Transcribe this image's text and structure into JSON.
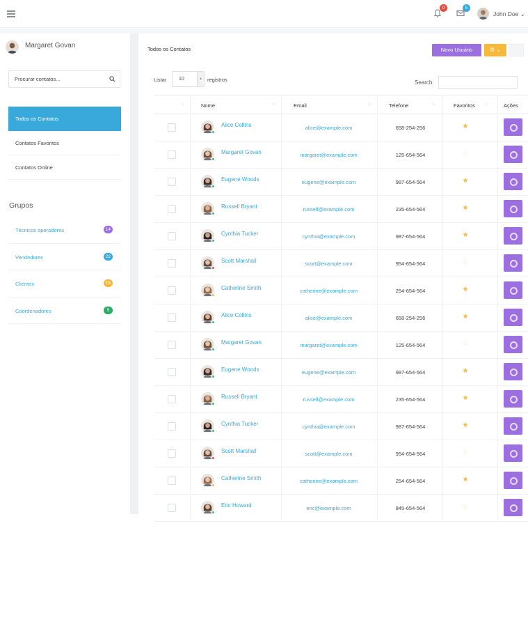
{
  "topbar": {
    "user_name": "John Doe",
    "user_caret": "⌄",
    "notification_count": "0",
    "message_count": "5",
    "colors": {
      "notification_badge": "#e74c3c",
      "message_badge": "#39a9db"
    }
  },
  "sidebar": {
    "profile_name": "Margaret Govan",
    "search_placeholder": "Procurar contatos...",
    "menu": [
      {
        "label": "Todos os Contatos",
        "active": true
      },
      {
        "label": "Contatos Favoritos"
      },
      {
        "label": "Contatos Online"
      }
    ],
    "groups_title": "Grupos",
    "groups": [
      {
        "label": "Técnicos operadores",
        "count": "14",
        "color": "#9b6fe0"
      },
      {
        "label": "Vendedores",
        "count": "22",
        "color": "#39a9db"
      },
      {
        "label": "Clientes",
        "count": "15",
        "color": "#f6b93b"
      },
      {
        "label": "Coordenadores",
        "count": "5",
        "color": "#27ae60"
      }
    ]
  },
  "main": {
    "title": "Todos os Contatos",
    "new_user_button": "Novo Usuário",
    "gear_button": "⚙ ⌄",
    "list_label": "Listar",
    "page_size": "10",
    "records_label": "registros",
    "search_label": "Search:",
    "columns": [
      "Nome",
      "Email",
      "Telefone",
      "Favoritos",
      "Ações"
    ],
    "rows": [
      {
        "name": "Alice Collins",
        "email": "alice@example.com",
        "phone": "658-254-256",
        "favorite": true,
        "status": "online"
      },
      {
        "name": "Margaret Govan",
        "email": "margaret@example.com",
        "phone": "125-654-564",
        "favorite": false,
        "status": "online"
      },
      {
        "name": "Eugene Woods",
        "email": "eugene@example.com",
        "phone": "987-654-564",
        "favorite": true,
        "status": "online"
      },
      {
        "name": "Russell Bryant",
        "email": "russell@example.com",
        "phone": "235-654-564",
        "favorite": true,
        "status": "online"
      },
      {
        "name": "Cynthia Tucker",
        "email": "cynthia@example.com",
        "phone": "987-654-564",
        "favorite": true,
        "status": "online"
      },
      {
        "name": "Scott Marshall",
        "email": "scott@example.com",
        "phone": "954-654-564",
        "favorite": false,
        "status": "busy"
      },
      {
        "name": "Catherine Smith",
        "email": "catherine@example.com",
        "phone": "254-654-564",
        "favorite": true,
        "status": "away"
      },
      {
        "name": "Alice Collins",
        "email": "alice@example.com",
        "phone": "658-254-256",
        "favorite": true,
        "status": "online"
      },
      {
        "name": "Margaret Govan",
        "email": "margaret@example.com",
        "phone": "125-654-564",
        "favorite": false,
        "status": "online"
      },
      {
        "name": "Eugene Woods",
        "email": "eugene@example.com",
        "phone": "987-654-564",
        "favorite": true,
        "status": "online"
      },
      {
        "name": "Russell Bryant",
        "email": "russell@example.com",
        "phone": "235-654-564",
        "favorite": true,
        "status": "online"
      },
      {
        "name": "Cynthia Tucker",
        "email": "cynthia@example.com",
        "phone": "987-654-564",
        "favorite": true,
        "status": "online"
      },
      {
        "name": "Scott Marshall",
        "email": "scott@example.com",
        "phone": "954-654-564",
        "favorite": false,
        "status": "busy"
      },
      {
        "name": "Catherine Smith",
        "email": "catherine@example.com",
        "phone": "254-654-564",
        "favorite": true,
        "status": "away"
      },
      {
        "name": "Eric Howard",
        "email": "eric@example.com",
        "phone": "845-654-564",
        "favorite": false,
        "status": "online"
      }
    ]
  }
}
